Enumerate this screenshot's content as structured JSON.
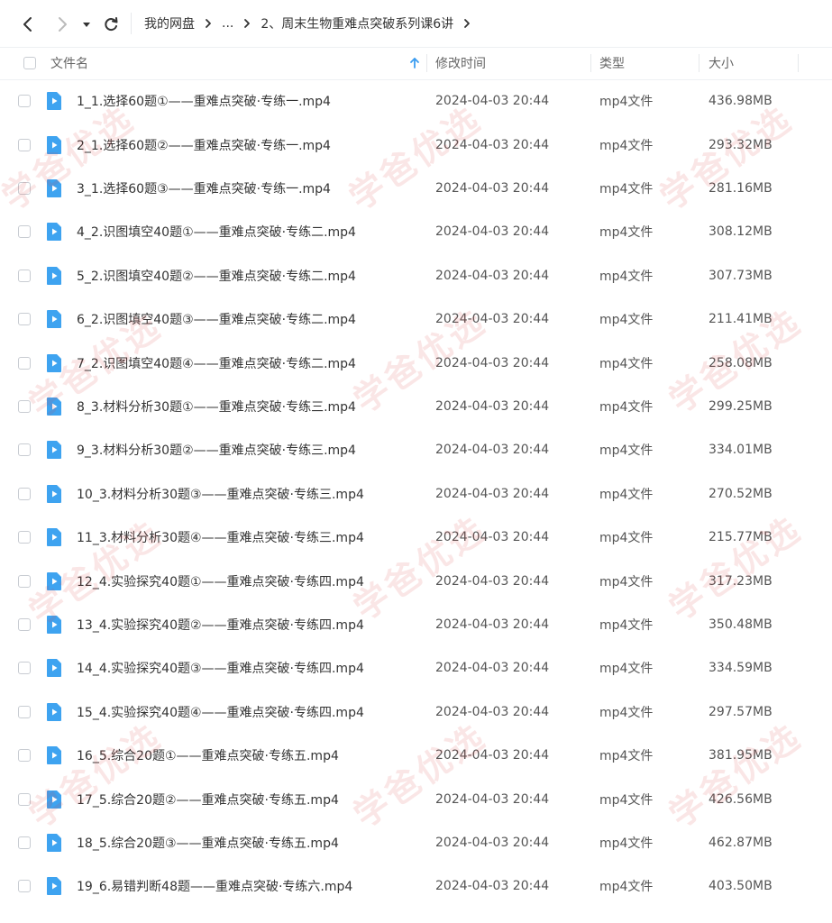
{
  "toolbar": {
    "icons": [
      "back-arrow-icon",
      "forward-arrow-icon",
      "history-dropdown-icon",
      "refresh-icon"
    ]
  },
  "breadcrumb": {
    "items": [
      "我的网盘",
      "...",
      "2、周末生物重难点突破系列课6讲"
    ]
  },
  "columns": {
    "name": "文件名",
    "modified": "修改时间",
    "type": "类型",
    "size": "大小"
  },
  "colors": {
    "file_icon": "#3ea3f0",
    "sort_arrow": "#3b9cf0",
    "watermark": "#d73c3c"
  },
  "files": [
    {
      "name": "1_1.选择60题①——重难点突破·专练一.mp4",
      "modified": "2024-04-03 20:44",
      "type": "mp4文件",
      "size": "436.98MB"
    },
    {
      "name": "2_1.选择60题②——重难点突破·专练一.mp4",
      "modified": "2024-04-03 20:44",
      "type": "mp4文件",
      "size": "293.32MB"
    },
    {
      "name": "3_1.选择60题③——重难点突破·专练一.mp4",
      "modified": "2024-04-03 20:44",
      "type": "mp4文件",
      "size": "281.16MB"
    },
    {
      "name": "4_2.识图填空40题①——重难点突破·专练二.mp4",
      "modified": "2024-04-03 20:44",
      "type": "mp4文件",
      "size": "308.12MB"
    },
    {
      "name": "5_2.识图填空40题②——重难点突破·专练二.mp4",
      "modified": "2024-04-03 20:44",
      "type": "mp4文件",
      "size": "307.73MB"
    },
    {
      "name": "6_2.识图填空40题③——重难点突破·专练二.mp4",
      "modified": "2024-04-03 20:44",
      "type": "mp4文件",
      "size": "211.41MB"
    },
    {
      "name": "7_2.识图填空40题④——重难点突破·专练二.mp4",
      "modified": "2024-04-03 20:44",
      "type": "mp4文件",
      "size": "258.08MB"
    },
    {
      "name": "8_3.材料分析30题①——重难点突破·专练三.mp4",
      "modified": "2024-04-03 20:44",
      "type": "mp4文件",
      "size": "299.25MB"
    },
    {
      "name": "9_3.材料分析30题②——重难点突破·专练三.mp4",
      "modified": "2024-04-03 20:44",
      "type": "mp4文件",
      "size": "334.01MB"
    },
    {
      "name": "10_3.材料分析30题③——重难点突破·专练三.mp4",
      "modified": "2024-04-03 20:44",
      "type": "mp4文件",
      "size": "270.52MB"
    },
    {
      "name": "11_3.材料分析30题④——重难点突破·专练三.mp4",
      "modified": "2024-04-03 20:44",
      "type": "mp4文件",
      "size": "215.77MB"
    },
    {
      "name": "12_4.实验探究40题①——重难点突破·专练四.mp4",
      "modified": "2024-04-03 20:44",
      "type": "mp4文件",
      "size": "317.23MB"
    },
    {
      "name": "13_4.实验探究40题②——重难点突破·专练四.mp4",
      "modified": "2024-04-03 20:44",
      "type": "mp4文件",
      "size": "350.48MB"
    },
    {
      "name": "14_4.实验探究40题③——重难点突破·专练四.mp4",
      "modified": "2024-04-03 20:44",
      "type": "mp4文件",
      "size": "334.59MB"
    },
    {
      "name": "15_4.实验探究40题④——重难点突破·专练四.mp4",
      "modified": "2024-04-03 20:44",
      "type": "mp4文件",
      "size": "297.57MB"
    },
    {
      "name": "16_5.综合20题①——重难点突破·专练五.mp4",
      "modified": "2024-04-03 20:44",
      "type": "mp4文件",
      "size": "381.95MB"
    },
    {
      "name": "17_5.综合20题②——重难点突破·专练五.mp4",
      "modified": "2024-04-03 20:44",
      "type": "mp4文件",
      "size": "426.56MB"
    },
    {
      "name": "18_5.综合20题③——重难点突破·专练五.mp4",
      "modified": "2024-04-03 20:44",
      "type": "mp4文件",
      "size": "462.87MB"
    },
    {
      "name": "19_6.易错判断48题——重难点突破·专练六.mp4",
      "modified": "2024-04-03 20:44",
      "type": "mp4文件",
      "size": "403.50MB"
    }
  ],
  "watermark": {
    "text": "学爸优选"
  }
}
